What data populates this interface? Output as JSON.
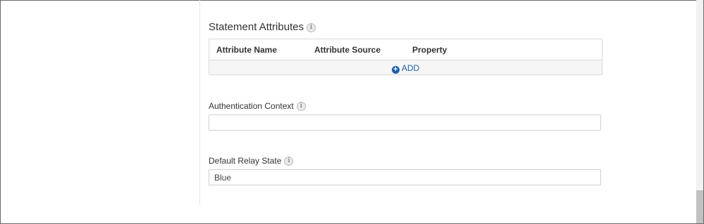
{
  "statement_attributes": {
    "title": "Statement Attributes",
    "info_icon": "info-icon",
    "columns": [
      "Attribute Name",
      "Attribute Source",
      "Property"
    ],
    "add_label": "ADD",
    "add_icon": "plus-circle-icon"
  },
  "authentication_context": {
    "label": "Authentication Context",
    "value": "",
    "info_icon": "info-icon"
  },
  "default_relay_state": {
    "label": "Default Relay State",
    "value": "Blue",
    "info_icon": "info-icon"
  },
  "colors": {
    "accent": "#1d5fa8",
    "border": "#d9d9d9",
    "add_row_bg": "#f6f6f6"
  }
}
